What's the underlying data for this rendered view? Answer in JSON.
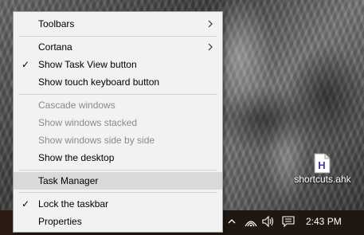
{
  "menu": {
    "items": [
      {
        "label": "Toolbars",
        "submenu": true,
        "checked": false,
        "disabled": false
      },
      {
        "label": "Cortana",
        "submenu": true,
        "checked": false,
        "disabled": false
      },
      {
        "label": "Show Task View button",
        "submenu": false,
        "checked": true,
        "disabled": false
      },
      {
        "label": "Show touch keyboard button",
        "submenu": false,
        "checked": false,
        "disabled": false
      },
      {
        "label": "Cascade windows",
        "submenu": false,
        "checked": false,
        "disabled": true
      },
      {
        "label": "Show windows stacked",
        "submenu": false,
        "checked": false,
        "disabled": true
      },
      {
        "label": "Show windows side by side",
        "submenu": false,
        "checked": false,
        "disabled": true
      },
      {
        "label": "Show the desktop",
        "submenu": false,
        "checked": false,
        "disabled": false
      },
      {
        "label": "Task Manager",
        "submenu": false,
        "checked": false,
        "disabled": false,
        "highlighted": true
      },
      {
        "label": "Lock the taskbar",
        "submenu": false,
        "checked": true,
        "disabled": false
      },
      {
        "label": "Properties",
        "submenu": false,
        "checked": false,
        "disabled": false
      }
    ],
    "check_glyph": "✓"
  },
  "desktop": {
    "file_label": "shortcuts.ahk",
    "file_icon_letter": "H"
  },
  "tray": {
    "clock": "2:43 PM",
    "icons": [
      "chevron-up-icon",
      "wifi-icon",
      "volume-icon",
      "notification-icon"
    ]
  },
  "colors": {
    "menu_bg": "#f2f2f2",
    "highlight": "#d9d9d9",
    "disabled_text": "#8a8a8a",
    "taskbar": "#1f1712"
  }
}
